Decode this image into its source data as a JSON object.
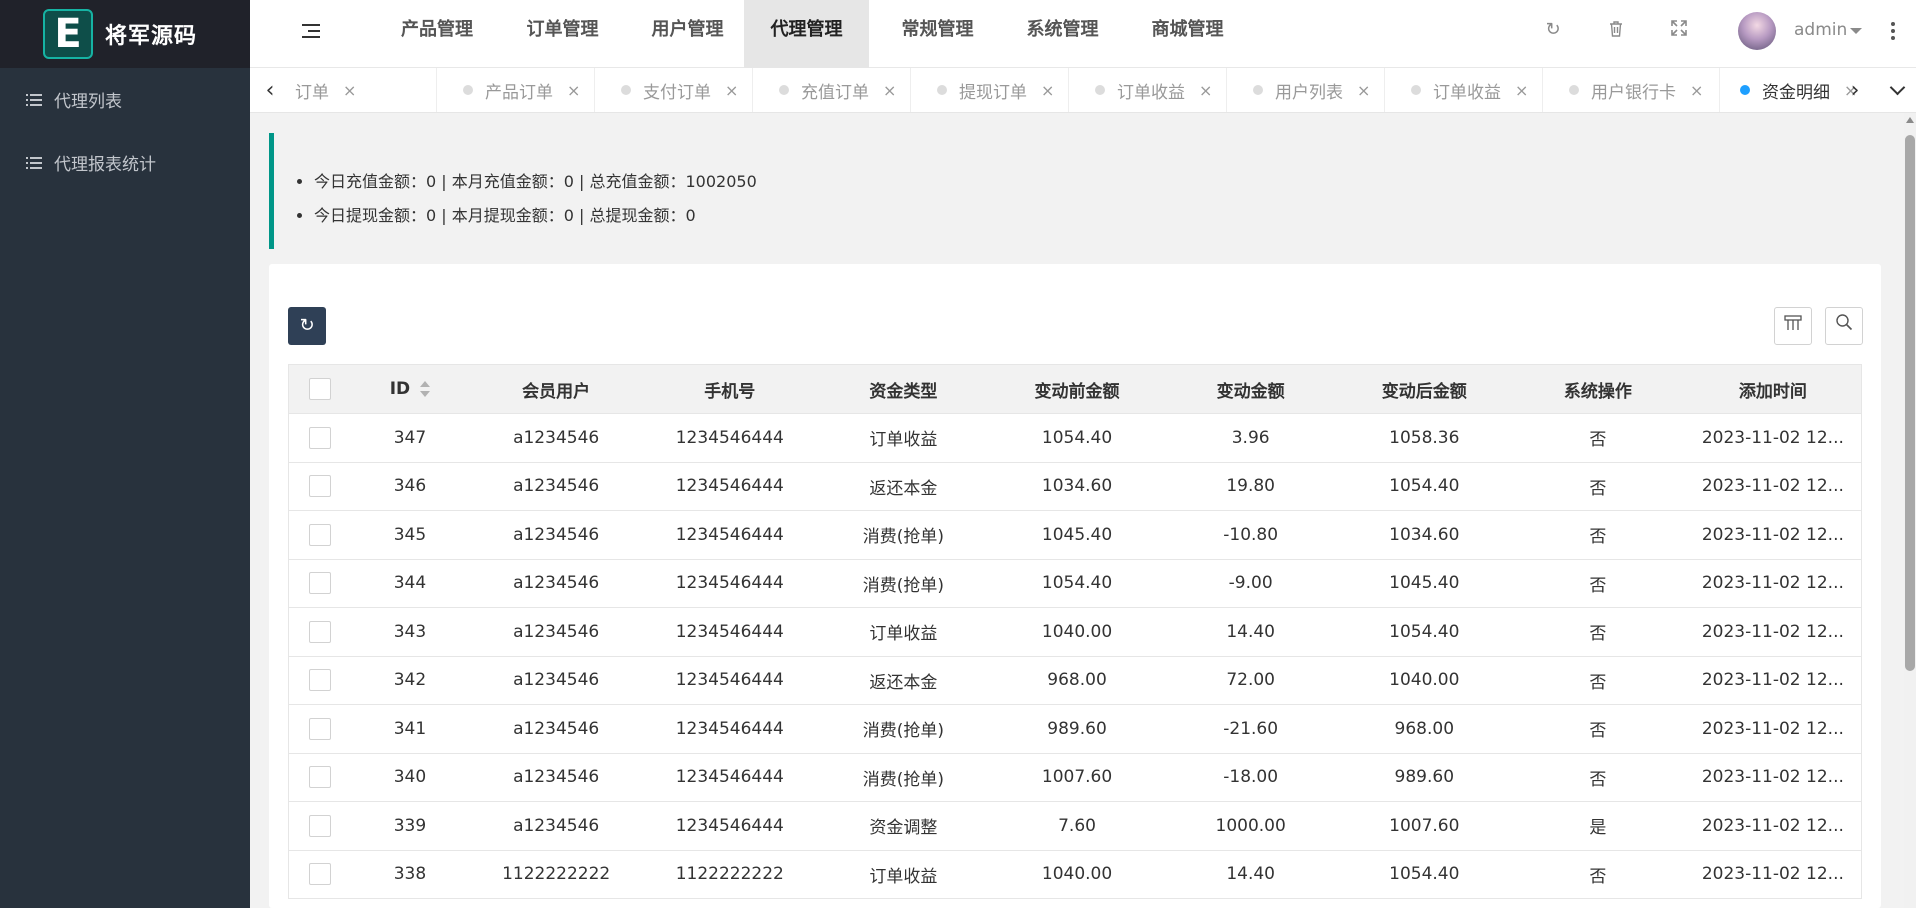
{
  "brand": {
    "logo_letter": "E",
    "name": "将军源码"
  },
  "sidebar": {
    "items": [
      {
        "label": "代理列表"
      },
      {
        "label": "代理报表统计"
      }
    ]
  },
  "header": {
    "nav": [
      {
        "label": "产品管理"
      },
      {
        "label": "订单管理"
      },
      {
        "label": "用户管理"
      },
      {
        "label": "代理管理",
        "active": true
      },
      {
        "label": "常规管理"
      },
      {
        "label": "系统管理"
      },
      {
        "label": "商城管理"
      }
    ],
    "icons": [
      "refresh-icon",
      "trash-icon",
      "fullscreen-icon"
    ],
    "user": {
      "name": "admin"
    }
  },
  "tabs": [
    {
      "label": "订单"
    },
    {
      "label": "产品订单"
    },
    {
      "label": "支付订单"
    },
    {
      "label": "充值订单"
    },
    {
      "label": "提现订单"
    },
    {
      "label": "订单收益"
    },
    {
      "label": "用户列表"
    },
    {
      "label": "订单收益"
    },
    {
      "label": "用户银行卡"
    },
    {
      "label": "资金明细",
      "active": true
    }
  ],
  "notice": {
    "lines": [
      "今日充值金额：0 | 本月充值金额：0 | 总充值金额：1002050",
      "今日提现金额：0 | 本月提现金额：0 | 总提现金额：0"
    ]
  },
  "colors": {
    "sidebar_bg": "#28323d",
    "logo_bg": "#20222a",
    "accent_teal": "#009688",
    "active_tab_dot": "#1e9fff",
    "refresh_button": "#2f4056"
  },
  "table": {
    "columns": [
      "ID",
      "会员用户",
      "手机号",
      "资金类型",
      "变动前金额",
      "变动金额",
      "变动后金额",
      "系统操作",
      "添加时间"
    ],
    "rows": [
      [
        "347",
        "a1234546",
        "1234546444",
        "订单收益",
        "1054.40",
        "3.96",
        "1058.36",
        "否",
        "2023-11-02 12..."
      ],
      [
        "346",
        "a1234546",
        "1234546444",
        "返还本金",
        "1034.60",
        "19.80",
        "1054.40",
        "否",
        "2023-11-02 12..."
      ],
      [
        "345",
        "a1234546",
        "1234546444",
        "消费(抢单)",
        "1045.40",
        "-10.80",
        "1034.60",
        "否",
        "2023-11-02 12..."
      ],
      [
        "344",
        "a1234546",
        "1234546444",
        "消费(抢单)",
        "1054.40",
        "-9.00",
        "1045.40",
        "否",
        "2023-11-02 12..."
      ],
      [
        "343",
        "a1234546",
        "1234546444",
        "订单收益",
        "1040.00",
        "14.40",
        "1054.40",
        "否",
        "2023-11-02 12..."
      ],
      [
        "342",
        "a1234546",
        "1234546444",
        "返还本金",
        "968.00",
        "72.00",
        "1040.00",
        "否",
        "2023-11-02 12..."
      ],
      [
        "341",
        "a1234546",
        "1234546444",
        "消费(抢单)",
        "989.60",
        "-21.60",
        "968.00",
        "否",
        "2023-11-02 12..."
      ],
      [
        "340",
        "a1234546",
        "1234546444",
        "消费(抢单)",
        "1007.60",
        "-18.00",
        "989.60",
        "否",
        "2023-11-02 12..."
      ],
      [
        "339",
        "a1234546",
        "1234546444",
        "资金调整",
        "7.60",
        "1000.00",
        "1007.60",
        "是",
        "2023-11-02 12..."
      ],
      [
        "338",
        "1122222222",
        "1122222222",
        "订单收益",
        "1040.00",
        "14.40",
        "1054.40",
        "否",
        "2023-11-02 12..."
      ]
    ]
  }
}
